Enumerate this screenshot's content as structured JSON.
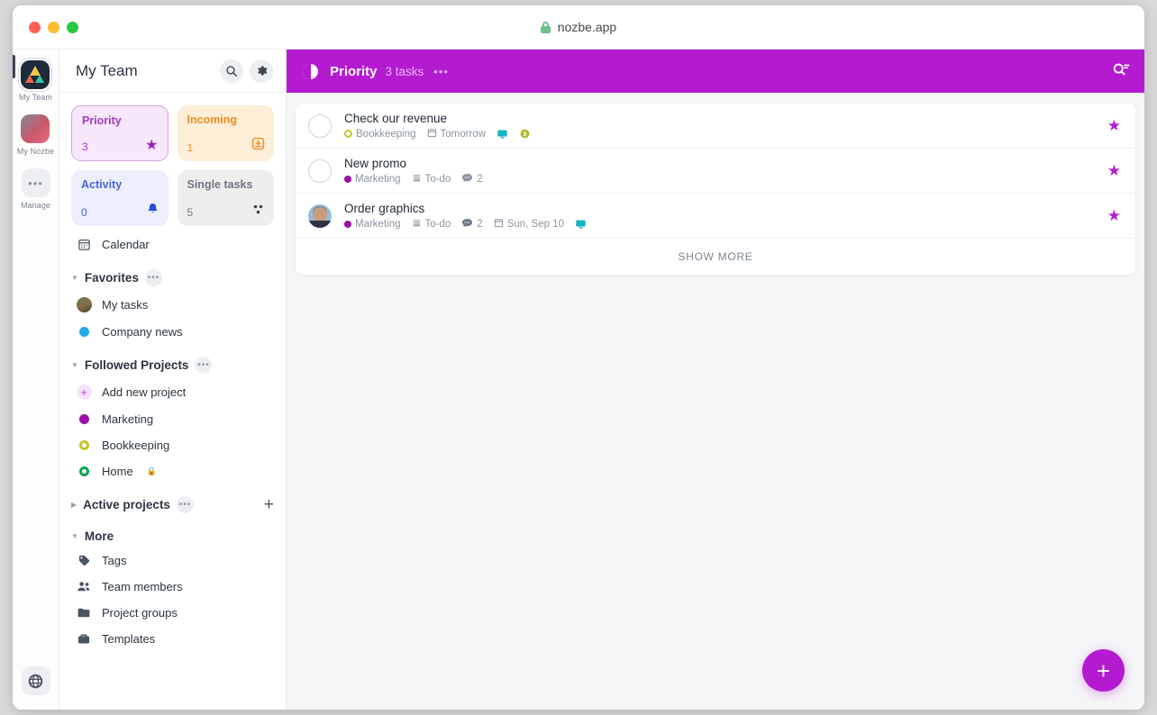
{
  "browser": {
    "url": "nozbe.app",
    "lock_icon": "lock-icon"
  },
  "rail": {
    "items": [
      {
        "label": "My Team",
        "icon": "team-logo-avatar"
      },
      {
        "label": "My Nozbe",
        "icon": "user-photo-avatar"
      },
      {
        "label": "Manage",
        "icon": "ellipsis-icon"
      }
    ],
    "bottom": {
      "icon": "globe-icon",
      "label": ""
    }
  },
  "sidebar": {
    "title": "My Team",
    "search_icon": "search-icon",
    "settings_icon": "gear-icon",
    "cards": [
      {
        "name": "Priority",
        "count": "3",
        "icon": "star-icon",
        "selected": true
      },
      {
        "name": "Incoming",
        "count": "1",
        "icon": "inbox-download-icon",
        "selected": false
      },
      {
        "name": "Activity",
        "count": "0",
        "icon": "bell-icon",
        "selected": false
      },
      {
        "name": "Single tasks",
        "count": "5",
        "icon": "dots-cluster-icon",
        "selected": false
      }
    ],
    "calendar": {
      "label": "Calendar",
      "icon": "calendar-icon"
    },
    "sections": [
      {
        "title": "Favorites",
        "expanded": true,
        "items": [
          {
            "label": "My tasks",
            "icon": "user-avatar-icon",
            "color": ""
          },
          {
            "label": "Company news",
            "icon": "project-dot-icon",
            "color": "#23a8ea"
          }
        ]
      },
      {
        "title": "Followed Projects",
        "expanded": true,
        "items": [
          {
            "label": "Add new project",
            "icon": "plus-circle-icon",
            "color": "#c23fd8"
          },
          {
            "label": "Marketing",
            "icon": "project-dot-icon",
            "color": "#9c0fa8"
          },
          {
            "label": "Bookkeeping",
            "icon": "project-ring-icon",
            "color": "#c3c72a"
          },
          {
            "label": "Home",
            "icon": "project-ring-icon",
            "color": "#0aa44f",
            "badge": "lock-icon"
          }
        ]
      },
      {
        "title": "Active projects",
        "expanded": false,
        "add_icon": "plus-icon",
        "items": []
      },
      {
        "title": "More",
        "expanded": true,
        "no_more_button": true,
        "items": [
          {
            "label": "Tags",
            "icon": "tag-icon"
          },
          {
            "label": "Team members",
            "icon": "people-icon"
          },
          {
            "label": "Project groups",
            "icon": "folder-icon"
          },
          {
            "label": "Templates",
            "icon": "briefcase-icon"
          }
        ]
      }
    ]
  },
  "main": {
    "header": {
      "icon": "half-circle-icon",
      "title": "Priority",
      "count": "3 tasks",
      "more_icon": "ellipsis-icon",
      "search_filter_icon": "search-filter-icon",
      "accent_color": "#b41bd1"
    },
    "tasks": [
      {
        "title": "Check our revenue",
        "lead": "checkbox",
        "starred": true,
        "meta": [
          {
            "type": "project",
            "label": "Bookkeeping",
            "icon": "project-ring-icon",
            "color": "#c3c72a"
          },
          {
            "type": "date",
            "label": "Tomorrow",
            "icon": "calendar-icon"
          },
          {
            "type": "badge",
            "label": "",
            "icon": "monitor-icon",
            "color": "#19b5c4"
          },
          {
            "type": "badge",
            "label": "",
            "icon": "dollar-coin-icon",
            "color": "#b0b92a"
          }
        ]
      },
      {
        "title": "New promo",
        "lead": "checkbox",
        "starred": true,
        "meta": [
          {
            "type": "project",
            "label": "Marketing",
            "icon": "project-dot-icon",
            "color": "#9c0fa8"
          },
          {
            "type": "category",
            "label": "To-do",
            "icon": "list-icon"
          },
          {
            "type": "comments",
            "label": "2",
            "icon": "comment-icon"
          }
        ]
      },
      {
        "title": "Order graphics",
        "lead": "avatar",
        "starred": true,
        "meta": [
          {
            "type": "project",
            "label": "Marketing",
            "icon": "project-dot-icon",
            "color": "#9c0fa8"
          },
          {
            "type": "category",
            "label": "To-do",
            "icon": "list-icon"
          },
          {
            "type": "comments",
            "label": "2",
            "icon": "comment-icon"
          },
          {
            "type": "date",
            "label": "Sun, Sep 10",
            "icon": "calendar-icon"
          },
          {
            "type": "badge",
            "label": "",
            "icon": "monitor-icon",
            "color": "#19b5c4"
          }
        ]
      }
    ],
    "show_more_label": "SHOW MORE",
    "fab_label": "+"
  }
}
